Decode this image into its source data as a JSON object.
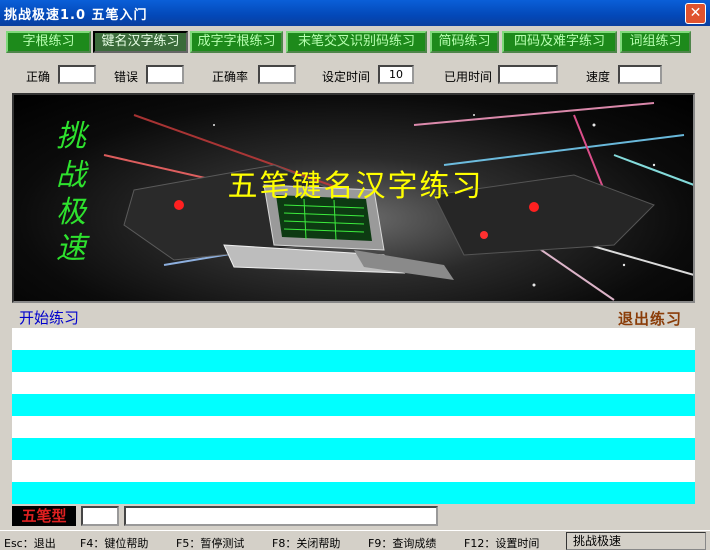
{
  "window": {
    "title": "挑战极速1.0   五笔入门",
    "close_glyph": "✕"
  },
  "tabs": [
    {
      "label": "字根练习",
      "active": false
    },
    {
      "label": "键名汉字练习",
      "active": true
    },
    {
      "label": "成字字根练习",
      "active": false
    },
    {
      "label": "末笔交叉识别码练习",
      "active": false
    },
    {
      "label": "简码练习",
      "active": false
    },
    {
      "label": "四码及难字练习",
      "active": false
    },
    {
      "label": "词组练习",
      "active": false
    }
  ],
  "stats": {
    "correct_label": "正确",
    "correct_value": "",
    "error_label": "错误",
    "error_value": "",
    "accuracy_label": "正确率",
    "accuracy_value": "",
    "set_time_label": "设定时间",
    "set_time_value": "10",
    "used_time_label": "已用时间",
    "used_time_value": "",
    "speed_label": "速度",
    "speed_value": ""
  },
  "banner": {
    "title": "五笔键名汉字练习",
    "vertical_chars": [
      "挑",
      "战",
      "极",
      "速"
    ]
  },
  "practice": {
    "start_label": "开始练习",
    "quit_label": "退出练习",
    "line_colors": [
      "#ffffff",
      "#00ffff"
    ]
  },
  "input": {
    "mode_badge": "五笔型",
    "code_value": "",
    "hint_value": ""
  },
  "statusbar": {
    "items": [
      "Esc：退出",
      "F4：键位帮助",
      "F5：暂停测试",
      "F8：关闭帮助",
      "F9：查询成绩",
      "F12：设置时间"
    ],
    "app_name": "挑战极速"
  },
  "colors": {
    "titlebar": "#0348b8",
    "tab_green": "#1d8a1b",
    "banner_text": "#ffff00",
    "vertical_text": "#2ee22e",
    "start_label": "#0000cc",
    "quit_label": "#8a3c08",
    "mode_badge_text": "#e02020"
  }
}
